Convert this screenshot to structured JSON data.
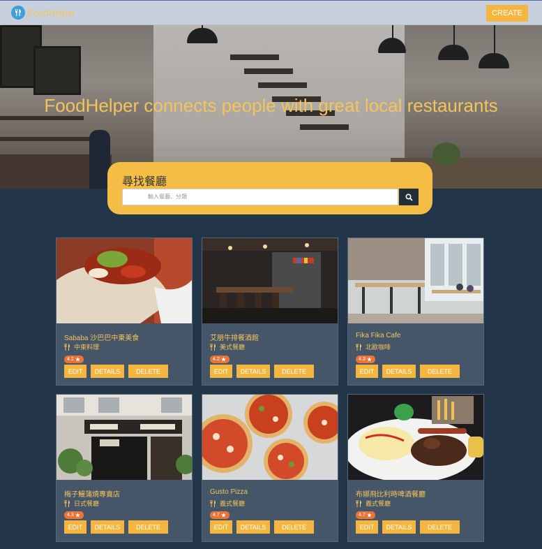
{
  "navbar": {
    "brand": "FoodHelper",
    "create_label": "CREATE"
  },
  "hero": {
    "title": "FoodHelper connects people with great local restaurants"
  },
  "search": {
    "title": "尋找餐廳",
    "placeholder": "輸入餐廳、分類"
  },
  "card_buttons": {
    "edit": "EDIT",
    "details": "DETAILS",
    "delete": "DELETE"
  },
  "restaurants": [
    {
      "name": "Sababa 沙巴巴中東美食",
      "category": "中東料理",
      "rating": "4.1"
    },
    {
      "name": "艾朋牛排餐酒館",
      "category": "美式餐廳",
      "rating": "4.2"
    },
    {
      "name": "Fika Fika Cafe",
      "category": "北歐咖啡",
      "rating": "4.3"
    },
    {
      "name": "梅子鰻蒲燒專賣店",
      "category": "日式餐廳",
      "rating": "4.3"
    },
    {
      "name": "Gusto Pizza",
      "category": "義式餐廳",
      "rating": "4.7"
    },
    {
      "name": "布娜飛比利時啤酒餐廳",
      "category": "義式餐廳",
      "rating": "4.7"
    }
  ],
  "colors": {
    "accent": "#f4b63f",
    "background": "#223549",
    "card": "#465669",
    "rating_badge": "#e8743a"
  },
  "icons": {
    "brand": "utensils-icon",
    "search": "search-icon",
    "category": "utensils-icon",
    "rating": "star-icon"
  }
}
